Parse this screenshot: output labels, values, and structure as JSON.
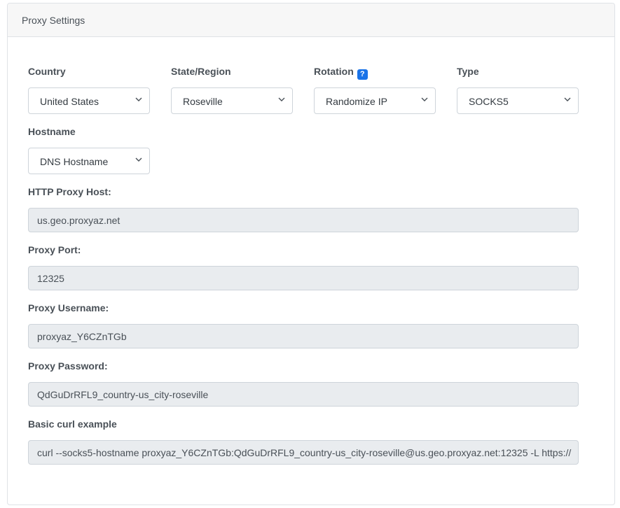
{
  "header": {
    "title": "Proxy Settings"
  },
  "fields": {
    "country": {
      "label": "Country",
      "value": "United States"
    },
    "state": {
      "label": "State/Region",
      "value": "Roseville"
    },
    "rotation": {
      "label": "Rotation",
      "help_glyph": "?",
      "value": "Randomize IP"
    },
    "type": {
      "label": "Type",
      "value": "SOCKS5"
    },
    "hostname": {
      "label": "Hostname",
      "value": "DNS Hostname"
    }
  },
  "details": {
    "http_proxy_host": {
      "label": "HTTP Proxy Host:",
      "value": "us.geo.proxyaz.net"
    },
    "proxy_port": {
      "label": "Proxy Port:",
      "value": "12325"
    },
    "proxy_username": {
      "label": "Proxy Username:",
      "value": "proxyaz_Y6CZnTGb"
    },
    "proxy_password": {
      "label": "Proxy Password:",
      "value": "QdGuDrRFL9_country-us_city-roseville"
    },
    "curl_example": {
      "label": "Basic curl example",
      "value": "curl --socks5-hostname proxyaz_Y6CZnTGb:QdGuDrRFL9_country-us_city-roseville@us.geo.proxyaz.net:12325 -L https://"
    }
  },
  "icons": {
    "chevron": "chevron-down-icon",
    "help": "help-icon"
  },
  "colors": {
    "help_badge": "#1a73e8",
    "readonly_bg": "#e9ecef",
    "header_bg": "#f7f7f7"
  }
}
